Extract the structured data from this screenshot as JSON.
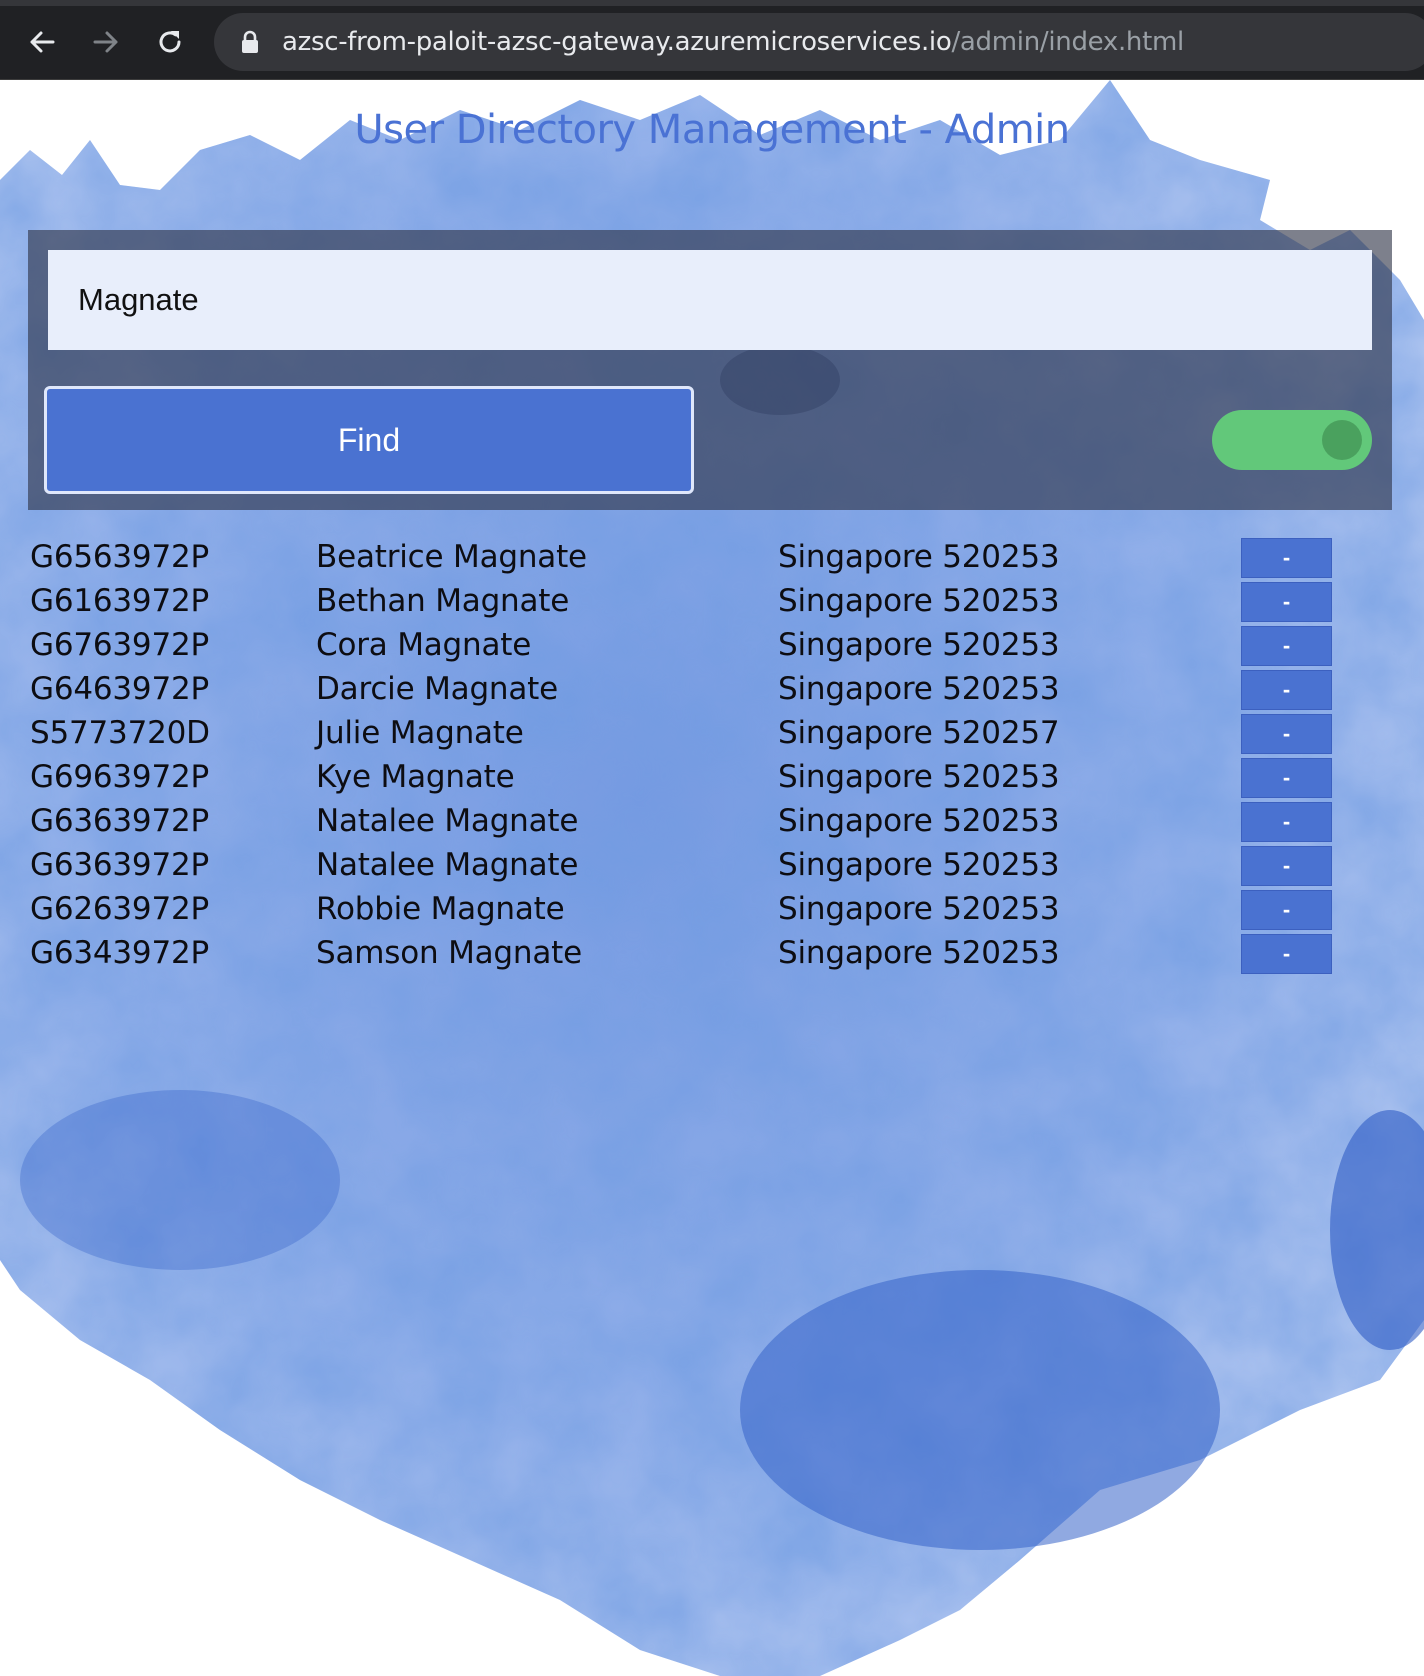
{
  "browser": {
    "url_host": "azsc-from-paloit-azsc-gateway.azuremicroservices.io",
    "url_path": "/admin/index.html"
  },
  "page": {
    "title": "User Directory Management - Admin"
  },
  "search": {
    "value": "Magnate",
    "find_label": "Find",
    "toggle_on": true
  },
  "results": [
    {
      "id": "G6563972P",
      "name": "Beatrice Magnate",
      "location": "Singapore 520253",
      "action": "-"
    },
    {
      "id": "G6163972P",
      "name": "Bethan Magnate",
      "location": "Singapore 520253",
      "action": "-"
    },
    {
      "id": "G6763972P",
      "name": "Cora Magnate",
      "location": "Singapore 520253",
      "action": "-"
    },
    {
      "id": "G6463972P",
      "name": "Darcie Magnate",
      "location": "Singapore 520253",
      "action": "-"
    },
    {
      "id": "S5773720D",
      "name": "Julie Magnate",
      "location": "Singapore 520257",
      "action": "-"
    },
    {
      "id": "G6963972P",
      "name": "Kye Magnate",
      "location": "Singapore 520253",
      "action": "-"
    },
    {
      "id": "G6363972P",
      "name": "Natalee Magnate",
      "location": "Singapore 520253",
      "action": "-"
    },
    {
      "id": "G6363972P",
      "name": "Natalee Magnate",
      "location": "Singapore 520253",
      "action": "-"
    },
    {
      "id": "G6263972P",
      "name": "Robbie Magnate",
      "location": "Singapore 520253",
      "action": "-"
    },
    {
      "id": "G6343972P",
      "name": "Samson Magnate",
      "location": "Singapore 520253",
      "action": "-"
    }
  ],
  "colors": {
    "accent": "#4a72d1",
    "toggle_on": "#62c87a",
    "watercolor": "#3f6fd0"
  },
  "icons": {
    "back": "back-arrow-icon",
    "forward": "forward-arrow-icon",
    "reload": "reload-icon",
    "lock": "lock-icon"
  }
}
